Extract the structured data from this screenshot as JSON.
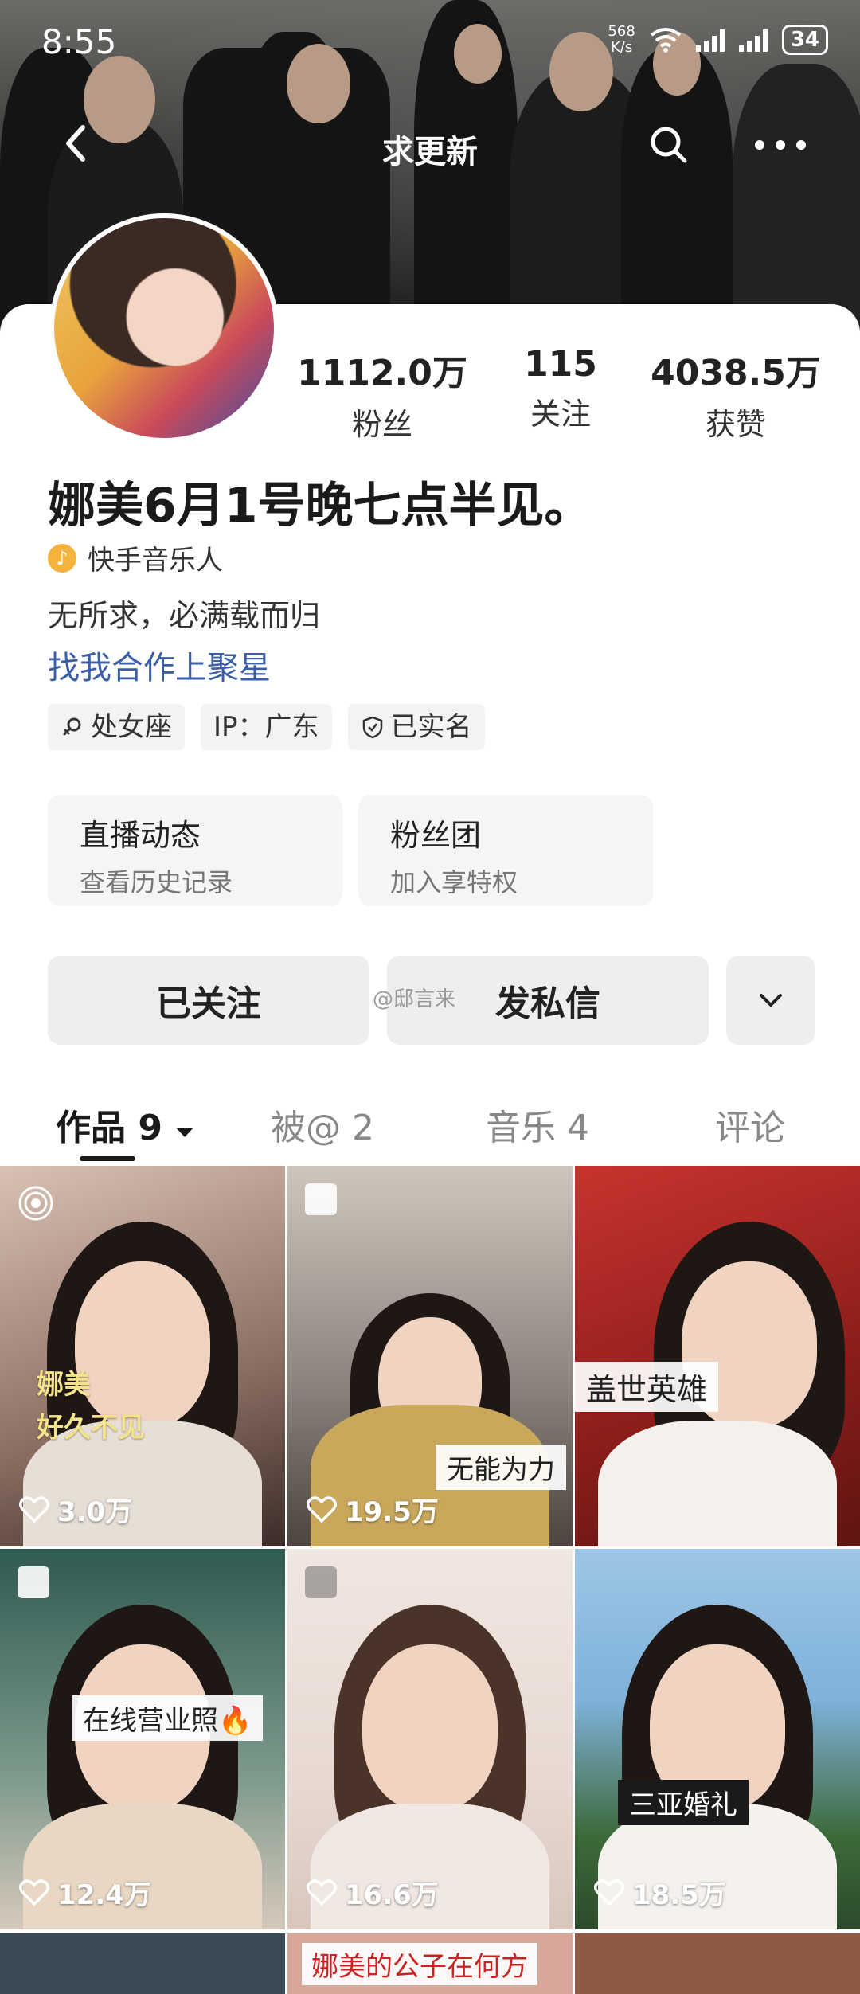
{
  "status": {
    "time": "8:55",
    "netspeed_value": "568",
    "netspeed_unit": "K/s",
    "wifi_badge": "6",
    "battery": "34"
  },
  "nav": {
    "title": "求更新",
    "back_icon": "chevron-left-icon",
    "search_icon": "search-icon",
    "more_icon": "more-dots-icon"
  },
  "profile": {
    "name": "娜美6月1号晚七点半见。",
    "badge": "快手音乐人",
    "bio": "无所求，必满载而归",
    "link": "找我合作上聚星",
    "stats": [
      {
        "value": "1112.0万",
        "label": "粉丝"
      },
      {
        "value": "115",
        "label": "关注"
      },
      {
        "value": "4038.5万",
        "label": "获赞"
      }
    ],
    "tags": [
      "处女座",
      "IP：广东",
      "已实名"
    ]
  },
  "features": [
    {
      "title": "直播动态",
      "subtitle": "查看历史记录"
    },
    {
      "title": "粉丝团",
      "subtitle": "加入享特权"
    }
  ],
  "actions": {
    "follow": "已关注",
    "message": "发私信",
    "watermark": "@邸言来"
  },
  "tabs": [
    {
      "label": "作品 9"
    },
    {
      "label": "被@ 2"
    },
    {
      "label": "音乐 4"
    },
    {
      "label": "评论"
    }
  ],
  "grid": [
    {
      "likes": "3.0万",
      "overlay": "娜美\n好久不见"
    },
    {
      "likes": "19.5万",
      "caption": "无能为力"
    },
    {
      "likes": "",
      "caption": "盖世英雄"
    },
    {
      "likes": "12.4万",
      "caption": "在线营业照🔥"
    },
    {
      "likes": "16.6万",
      "caption": ""
    },
    {
      "likes": "18.5万",
      "caption": "三亚婚礼"
    }
  ],
  "bottom_strip_caption": "娜美的公子在何方"
}
